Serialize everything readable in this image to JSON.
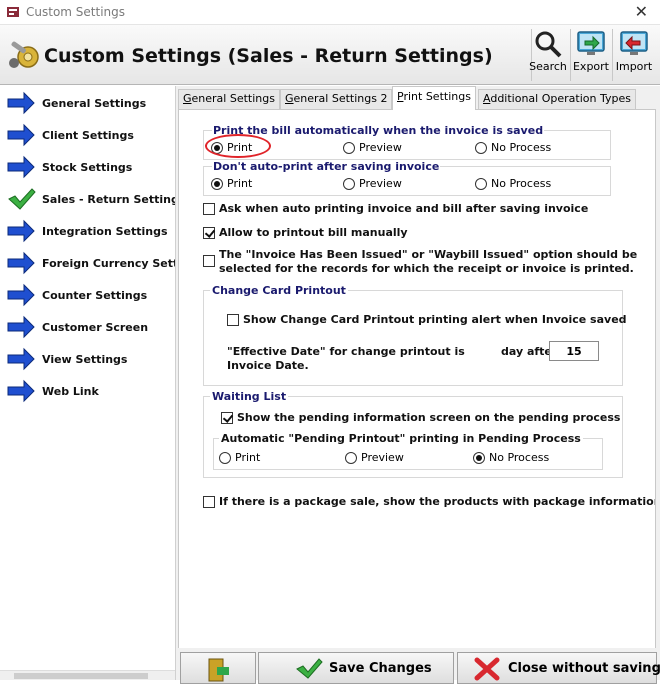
{
  "window": {
    "title": "Custom Settings"
  },
  "header": {
    "title": "Custom Settings (Sales - Return Settings)"
  },
  "toolbar": {
    "search": "Search",
    "export": "Export",
    "import": "Import"
  },
  "sidebar": {
    "items": [
      {
        "label": "General Settings",
        "icon": "arrow-right-icon"
      },
      {
        "label": "Client Settings",
        "icon": "arrow-right-icon"
      },
      {
        "label": "Stock Settings",
        "icon": "arrow-right-icon"
      },
      {
        "label": "Sales - Return Settings",
        "icon": "checkmark-icon",
        "selected": true
      },
      {
        "label": "Integration Settings",
        "icon": "arrow-right-icon"
      },
      {
        "label": "Foreign Currency Settings",
        "icon": "arrow-right-icon"
      },
      {
        "label": "Counter Settings",
        "icon": "arrow-right-icon"
      },
      {
        "label": "Customer Screen",
        "icon": "arrow-right-icon"
      },
      {
        "label": "View Settings",
        "icon": "arrow-right-icon"
      },
      {
        "label": "Web Link",
        "icon": "arrow-right-icon"
      }
    ]
  },
  "tabs": [
    {
      "label": "General Settings",
      "underline": "G",
      "rest": "eneral Settings"
    },
    {
      "label": "General Settings 2",
      "underline": "G",
      "rest": "eneral Settings 2"
    },
    {
      "label": "Print Settings",
      "underline": "P",
      "rest": "rint Settings",
      "active": true
    },
    {
      "label": "Additional Operation Types",
      "underline": "A",
      "rest": "dditional Operation Types"
    }
  ],
  "print_bill": {
    "title": "Print the bill automatically when the invoice is saved",
    "options": [
      "Print",
      "Preview",
      "No Process"
    ],
    "selected": "Print"
  },
  "dont_autoprint": {
    "title": "Don't auto-print after saving invoice",
    "options": [
      "Print",
      "Preview",
      "No Process"
    ],
    "selected": "Print"
  },
  "checks": {
    "ask_auto_print": {
      "label": "Ask when auto printing invoice and bill after saving invoice",
      "checked": false
    },
    "allow_manual": {
      "label": "Allow to printout bill manually",
      "checked": true
    },
    "invoice_issued_line1": "The \"Invoice Has Been Issued\" or \"Waybill Issued\" option should be",
    "invoice_issued_line2": "selected for the records for which the receipt or invoice is printed.",
    "invoice_issued_checked": false
  },
  "change_card": {
    "title": "Change Card Printout",
    "show_alert": {
      "label": "Show Change Card Printout printing alert when Invoice saved",
      "checked": false
    },
    "effective_line1": "\"Effective Date\" for change printout is",
    "effective_line2": "Invoice Date.",
    "day_after_label": "day after",
    "day_value": "15"
  },
  "waiting_list": {
    "title": "Waiting List",
    "show_pending": {
      "label": "Show the pending information screen on the pending process",
      "checked": true
    },
    "auto_pending_title": "Automatic \"Pending Printout\" printing in Pending Process",
    "options": [
      "Print",
      "Preview",
      "No Process"
    ],
    "selected": "No Process"
  },
  "package_sale": {
    "label": "If there is a package sale, show the products with package information on a single line",
    "checked": false
  },
  "buttons": {
    "save": "Save Changes",
    "close": "Close without saving"
  },
  "colors": {
    "group_title": "#1a1a6e",
    "highlight": "#e0242a",
    "arrow_blue": "#1f4fd0",
    "check_green": "#3cb043"
  }
}
